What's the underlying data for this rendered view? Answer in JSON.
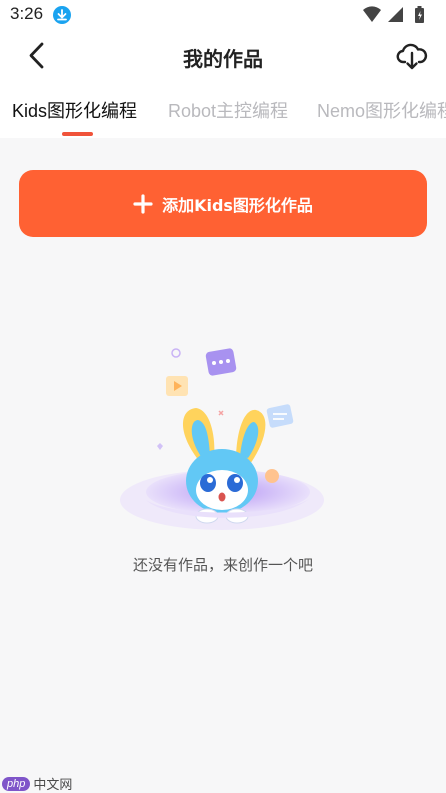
{
  "status_bar": {
    "time": "3:26"
  },
  "header": {
    "title": "我的作品"
  },
  "tabs": [
    {
      "label": "Kids图形化编程",
      "active": true
    },
    {
      "label": "Robot主控编程",
      "active": false
    },
    {
      "label": "Nemo图形化编程",
      "active": false
    }
  ],
  "add_button": {
    "label": "添加Kids图形化作品"
  },
  "empty_state": {
    "message": "还没有作品，来创作一个吧"
  },
  "watermark": {
    "badge": "php",
    "text": "中文网"
  },
  "colors": {
    "accent": "#ff6133",
    "tab_indicator": "#f0533a",
    "background": "#f7f7f8"
  },
  "icons": [
    "download-badge-icon",
    "wifi-icon",
    "signal-icon",
    "battery-icon",
    "back-arrow-icon",
    "cloud-download-icon",
    "plus-icon"
  ]
}
